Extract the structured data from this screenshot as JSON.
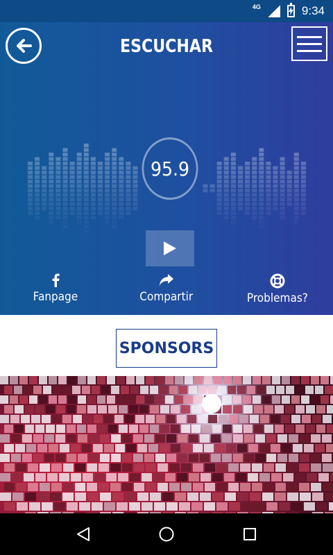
{
  "status_bar": {
    "network": "4G",
    "time": "9:34",
    "icons": [
      "network-type-icon",
      "signal-icon",
      "battery-charging-icon"
    ]
  },
  "header": {
    "title": "ESCUCHAR",
    "back_icon": "back-arrow-icon",
    "menu_icon": "hamburger-menu-icon"
  },
  "player": {
    "frequency": "95.9",
    "play_icon": "play-icon"
  },
  "actions": [
    {
      "label": "Fanpage",
      "icon": "facebook-icon"
    },
    {
      "label": "Compartir",
      "icon": "share-icon"
    },
    {
      "label": "Problemas?",
      "icon": "lifebuoy-icon"
    }
  ],
  "sponsors": {
    "label": "SPONSORS"
  },
  "colors": {
    "hero_left": "#115a98",
    "hero_right": "#2f3d9e",
    "accent": "#1a3a8a"
  },
  "navigation": {
    "icons": [
      "nav-back-icon",
      "nav-home-icon",
      "nav-recents-icon"
    ]
  }
}
